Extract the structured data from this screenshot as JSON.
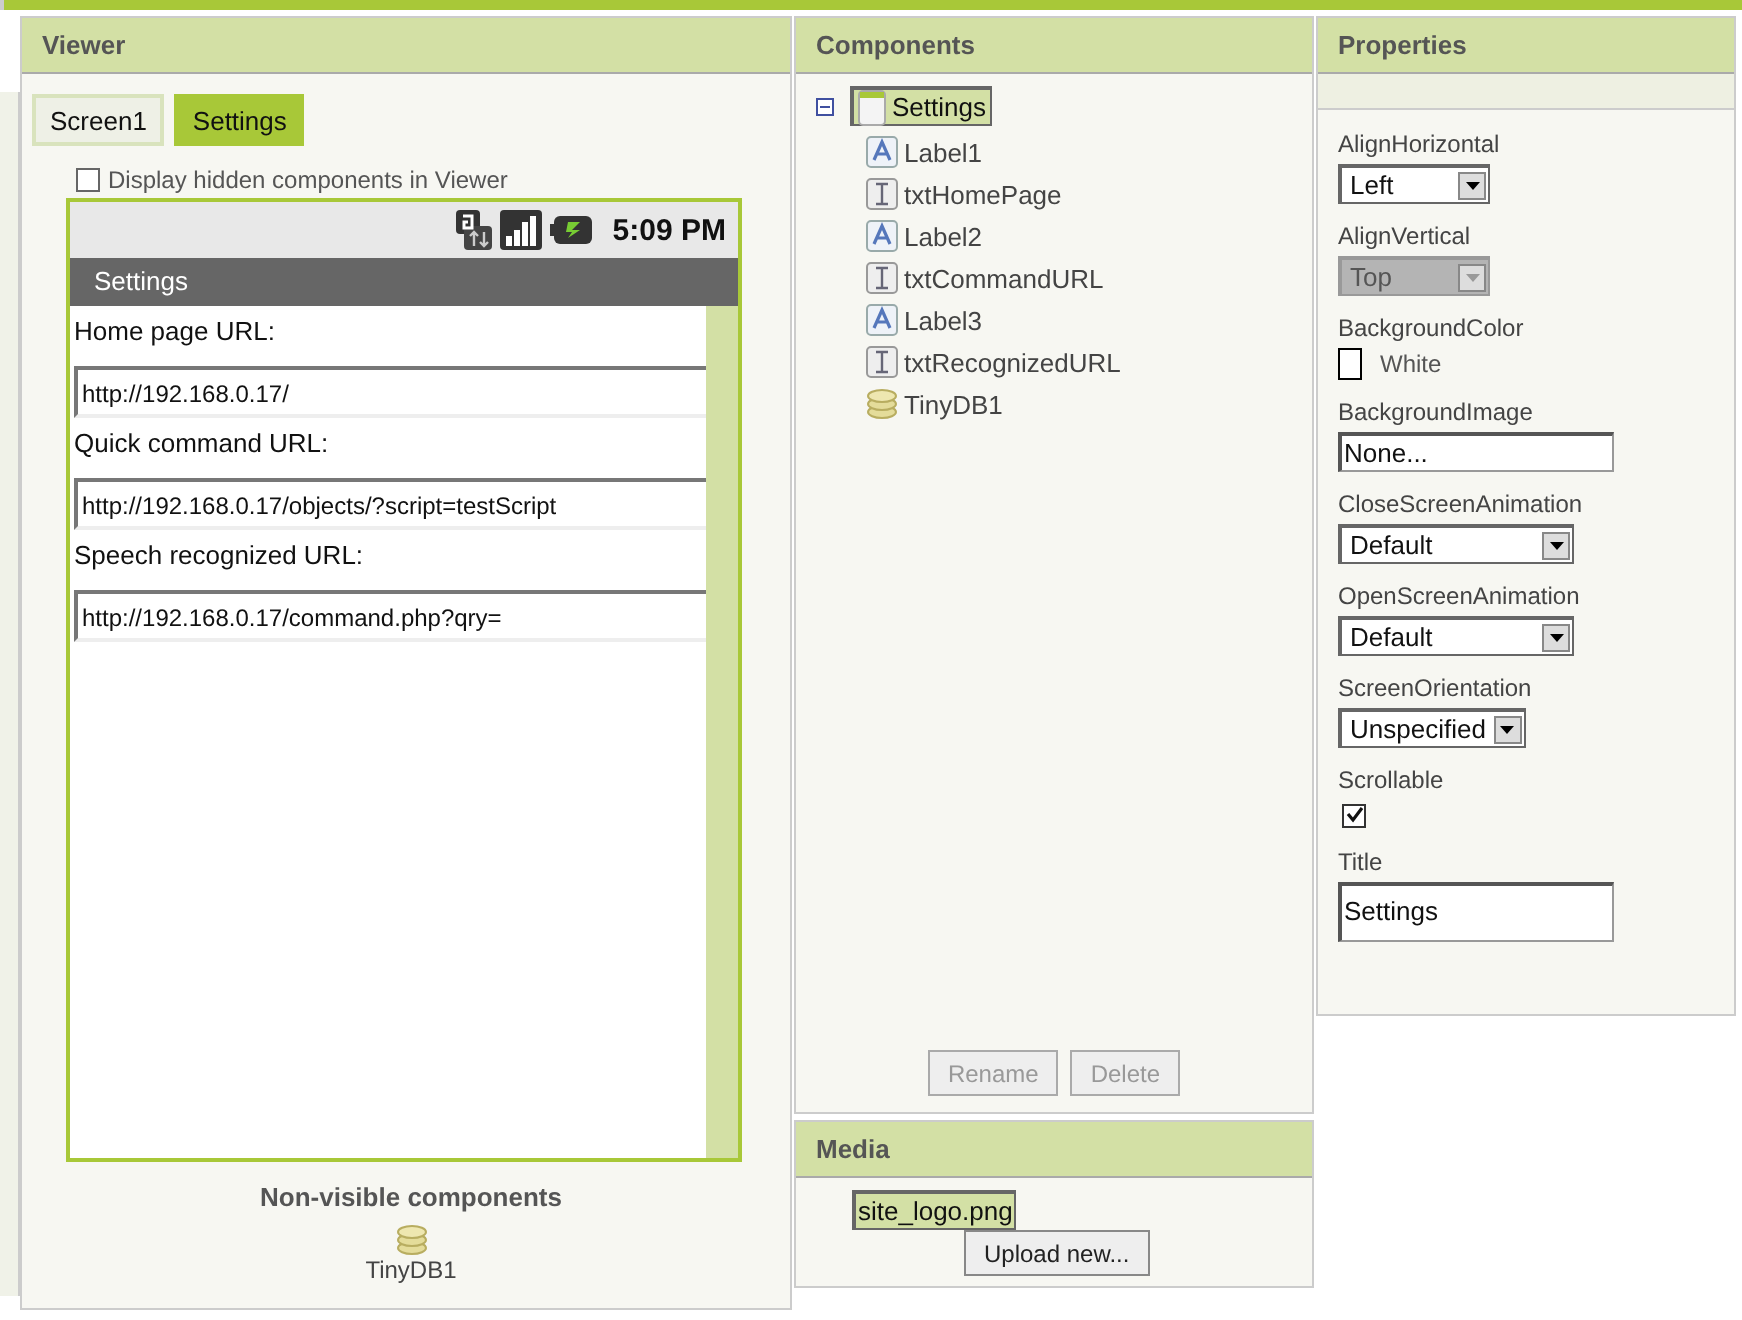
{
  "viewer": {
    "title": "Viewer",
    "screens": [
      {
        "label": "Screen1",
        "selected": false
      },
      {
        "label": "Settings",
        "selected": true
      }
    ],
    "hidden_toggle": {
      "label": "Display hidden components in Viewer",
      "checked": false
    },
    "phone": {
      "time": "5:09 PM",
      "title": "Settings",
      "rows": [
        {
          "kind": "label",
          "text": "Home page URL:"
        },
        {
          "kind": "textbox",
          "value": "http://192.168.0.17/"
        },
        {
          "kind": "label",
          "text": "Quick command URL:"
        },
        {
          "kind": "textbox",
          "value": "http://192.168.0.17/objects/?script=testScript"
        },
        {
          "kind": "label",
          "text": "Speech recognized URL:"
        },
        {
          "kind": "textbox",
          "value": "http://192.168.0.17/command.php?qry="
        }
      ]
    },
    "non_visible": {
      "title": "Non-visible components",
      "items": [
        {
          "kind": "tinydb",
          "name": "TinyDB1"
        }
      ]
    }
  },
  "components": {
    "title": "Components",
    "tree": [
      {
        "kind": "screen",
        "name": "Settings",
        "selected": true,
        "expanded": true,
        "children": [
          {
            "kind": "label",
            "name": "Label1",
            "selected": false
          },
          {
            "kind": "textbox",
            "name": "txtHomePage",
            "selected": false
          },
          {
            "kind": "label",
            "name": "Label2",
            "selected": false
          },
          {
            "kind": "textbox",
            "name": "txtCommandURL",
            "selected": false
          },
          {
            "kind": "label",
            "name": "Label3",
            "selected": false
          },
          {
            "kind": "textbox",
            "name": "txtRecognizedURL",
            "selected": false
          },
          {
            "kind": "tinydb",
            "name": "TinyDB1",
            "selected": false
          }
        ]
      }
    ],
    "buttons": [
      {
        "label": "Rename",
        "disabled": true
      },
      {
        "label": "Delete",
        "disabled": true
      }
    ]
  },
  "media": {
    "title": "Media",
    "files": [
      {
        "name": "site_logo.png",
        "selected": true
      }
    ],
    "upload_button": "Upload new..."
  },
  "properties": {
    "title": "Properties",
    "items": [
      {
        "kind": "select",
        "label": "AlignHorizontal",
        "value": "Left",
        "disabled": false
      },
      {
        "kind": "select",
        "label": "AlignVertical",
        "value": "Top",
        "disabled": true
      },
      {
        "kind": "color",
        "label": "BackgroundColor",
        "value": "White",
        "color": "#ffffff"
      },
      {
        "kind": "text",
        "label": "BackgroundImage",
        "value": "None..."
      },
      {
        "kind": "select",
        "label": "CloseScreenAnimation",
        "value": "Default",
        "disabled": false,
        "wide": true
      },
      {
        "kind": "select",
        "label": "OpenScreenAnimation",
        "value": "Default",
        "disabled": false,
        "wide": true
      },
      {
        "kind": "select",
        "label": "ScreenOrientation",
        "value": "Unspecified",
        "disabled": false
      },
      {
        "kind": "checkbox",
        "label": "Scrollable",
        "checked": true
      },
      {
        "kind": "textarea",
        "label": "Title",
        "value": "Settings"
      }
    ]
  }
}
